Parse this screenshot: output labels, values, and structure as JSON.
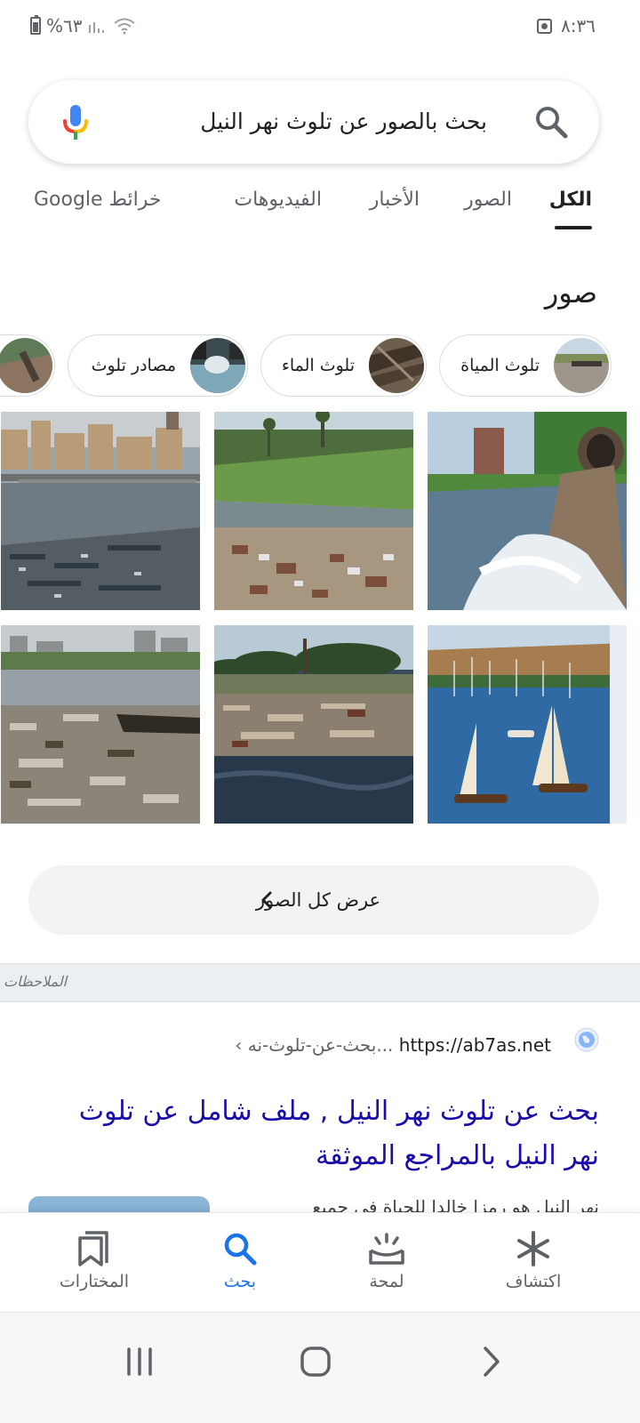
{
  "status_bar": {
    "battery_text": "%٦٣",
    "time": "٨:٣٦"
  },
  "search": {
    "query": "بحث بالصور عن تلوث نهر النيل"
  },
  "tabs": [
    {
      "label": "الكل",
      "active": true
    },
    {
      "label": "الصور",
      "active": false
    },
    {
      "label": "الأخبار",
      "active": false
    },
    {
      "label": "الفيديوهات",
      "active": false
    },
    {
      "label": "خرائط Google",
      "active": false
    }
  ],
  "images_section": {
    "title": "صور",
    "chips": [
      {
        "label": "تلوث المياة"
      },
      {
        "label": "تلوث الماء"
      },
      {
        "label": "مصادر تلوث"
      }
    ],
    "view_all_label": "عرض كل الصور"
  },
  "notes_label": "الملاحظات",
  "result": {
    "domain": "https://ab7as.net",
    "path": "‹ بحث-عن-تلوث-نه...",
    "title": "بحث عن تلوث نهر النيل , ملف شامل عن تلوث نهر النيل بالمراجع الموثقة",
    "snippet": "نهر النيل هو رمزا خالدا للحياة في جميع"
  },
  "bottom_nav": [
    {
      "label": "اكتشاف",
      "icon": "asterisk-icon",
      "active": false
    },
    {
      "label": "لمحة",
      "icon": "snapshot-icon",
      "active": false
    },
    {
      "label": "بحث",
      "icon": "search-icon",
      "active": true
    },
    {
      "label": "المختارات",
      "icon": "bookmarks-icon",
      "active": false
    }
  ],
  "colors": {
    "accent": "#1a73e8",
    "link": "#1a0dab"
  }
}
